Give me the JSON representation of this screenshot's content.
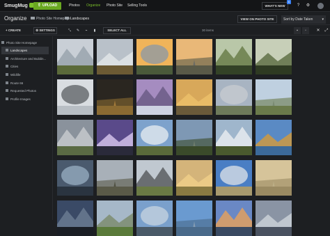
{
  "app": {
    "logo": "SmugMug",
    "upload_label": "UPLOAD",
    "nav": [
      "Photos",
      "Organize",
      "Photo Site",
      "Selling Tools"
    ],
    "active_nav": "Organize",
    "whats_new_label": "WHAT'S NEW",
    "whats_new_badge": "6",
    "icons": [
      "help-icon",
      "gear-icon",
      "avatar"
    ]
  },
  "header": {
    "title": "Organize",
    "breadcrumb": [
      "Photo Site Homepage",
      "Landscapes"
    ],
    "view_on_site_label": "VIEW ON PHOTO SITE",
    "sort_label": "Sort by Date Taken"
  },
  "toolbar": {
    "create_label": "CREATE",
    "settings_label": "SETTINGS",
    "select_all_label": "SELECT ALL",
    "count_label": "30 items",
    "tool_icons": [
      "move-icon",
      "edit-icon",
      "link-icon",
      "delete-icon"
    ]
  },
  "sidebar": {
    "items": [
      {
        "label": "Photo Site Homepage",
        "active": false,
        "indent": 0
      },
      {
        "label": "Landscapes",
        "active": true,
        "indent": 1
      },
      {
        "label": "Architecture and Buildin...",
        "active": false,
        "indent": 1
      },
      {
        "label": "Cities",
        "active": false,
        "indent": 1
      },
      {
        "label": "Wildlife",
        "active": false,
        "indent": 1
      },
      {
        "label": "Route 66",
        "active": false,
        "indent": 1
      },
      {
        "label": "Requested Photos",
        "active": false,
        "indent": 1
      },
      {
        "label": "Profile Images",
        "active": false,
        "indent": 1
      }
    ]
  },
  "colors": {
    "accent": "#7bbf2a",
    "upload_bg": "#6aa821",
    "badge": "#3b82f6",
    "topbar_bg": "#141517",
    "page_bg": "#1d1f22"
  },
  "photos": [
    {
      "name": "mountain-waterfall",
      "sky": "#c9cfd6",
      "ground": "#5b6a3a",
      "accent": "#9aa4ae"
    },
    {
      "name": "cascade-valley",
      "sky": "#b9c1c9",
      "ground": "#6b5a34",
      "accent": "#e3e7ea"
    },
    {
      "name": "mountain-sunset",
      "sky": "#f0b45a",
      "ground": "#4a5a3a",
      "accent": "#8a98a8"
    },
    {
      "name": "mountain-dawn",
      "sky": "#e9b878",
      "ground": "#5a5a48",
      "accent": "#7a8090"
    },
    {
      "name": "tree-tunnel",
      "sky": "#b9c7a8",
      "ground": "#334226",
      "accent": "#6a7e4a"
    },
    {
      "name": "tree-avenue",
      "sky": "#c7cfb8",
      "ground": "#2e3a22",
      "accent": "#5a6a40"
    },
    {
      "name": "sea-arch",
      "sky": "#d9dde1",
      "ground": "#b8bec4",
      "accent": "#5a5e62"
    },
    {
      "name": "night-cave",
      "sky": "#2a2620",
      "ground": "#8a6a32",
      "accent": "#d8a04a"
    },
    {
      "name": "purple-mountain",
      "sky": "#a58cc0",
      "ground": "#cdd2e2",
      "accent": "#6b5c86"
    },
    {
      "name": "golden-mountain",
      "sky": "#d8a85a",
      "ground": "#6a5a3a",
      "accent": "#eec06a"
    },
    {
      "name": "valley-road",
      "sky": "#a8b4c2",
      "ground": "#6e7a5a",
      "accent": "#c8ccd0"
    },
    {
      "name": "mountain-meadow",
      "sky": "#bfd0e0",
      "ground": "#6a7a4a",
      "accent": "#8d9eaa"
    },
    {
      "name": "dramatic-clouds",
      "sky": "#8a929c",
      "ground": "#5a6a44",
      "accent": "#c4c8cc"
    },
    {
      "name": "galaxy-peaks",
      "sky": "#5a4a8a",
      "ground": "#2a2a3a",
      "accent": "#d9c8ef"
    },
    {
      "name": "yosemite-falls",
      "sky": "#7da2cc",
      "ground": "#5a6a3a",
      "accent": "#eaeef2"
    },
    {
      "name": "alpine-lake",
      "sky": "#7e98b4",
      "ground": "#3a4a2a",
      "accent": "#c2ccd6"
    },
    {
      "name": "tall-waterfall",
      "sky": "#9fb6cc",
      "ground": "#4a5a2e",
      "accent": "#e6ebef"
    },
    {
      "name": "autumn-lake",
      "sky": "#5a8ac4",
      "ground": "#3c6a9a",
      "accent": "#d49a3a"
    },
    {
      "name": "coastal-storm",
      "sky": "#4a5a6e",
      "ground": "#2a3440",
      "accent": "#9ab0c4"
    },
    {
      "name": "rocky-hill",
      "sky": "#a8b0b8",
      "ground": "#5a5a48",
      "accent": "#3a3a32"
    },
    {
      "name": "highland-road",
      "sky": "#c0c8d0",
      "ground": "#6a7a44",
      "accent": "#5a5e62"
    },
    {
      "name": "golden-field",
      "sky": "#d4b47a",
      "ground": "#8a7a42",
      "accent": "#f0d08a"
    },
    {
      "name": "desert-road-blue",
      "sky": "#4a7ec4",
      "ground": "#a89a6e",
      "accent": "#e0e4e8"
    },
    {
      "name": "desert-road-sun",
      "sky": "#d6c49a",
      "ground": "#9a8a62",
      "accent": "#f2e4c0"
    },
    {
      "name": "dark-peak",
      "sky": "#3a4a66",
      "ground": "#1a1e24",
      "accent": "#6a7a90"
    },
    {
      "name": "green-ridge",
      "sky": "#a6b8c8",
      "ground": "#5a7a3a",
      "accent": "#7a8a6a"
    },
    {
      "name": "sky-peaks",
      "sky": "#7aa0cc",
      "ground": "#4a5a68",
      "accent": "#c8d4e0"
    },
    {
      "name": "bright-clouds",
      "sky": "#6a9ad0",
      "ground": "#4a6a8a",
      "accent": "#e8eef4"
    },
    {
      "name": "sunset-coast",
      "sky": "#6a88c4",
      "ground": "#3a4a62",
      "accent": "#e0a060"
    },
    {
      "name": "misty-peak",
      "sky": "#8a94a4",
      "ground": "#4a5260",
      "accent": "#cdd3da"
    }
  ]
}
